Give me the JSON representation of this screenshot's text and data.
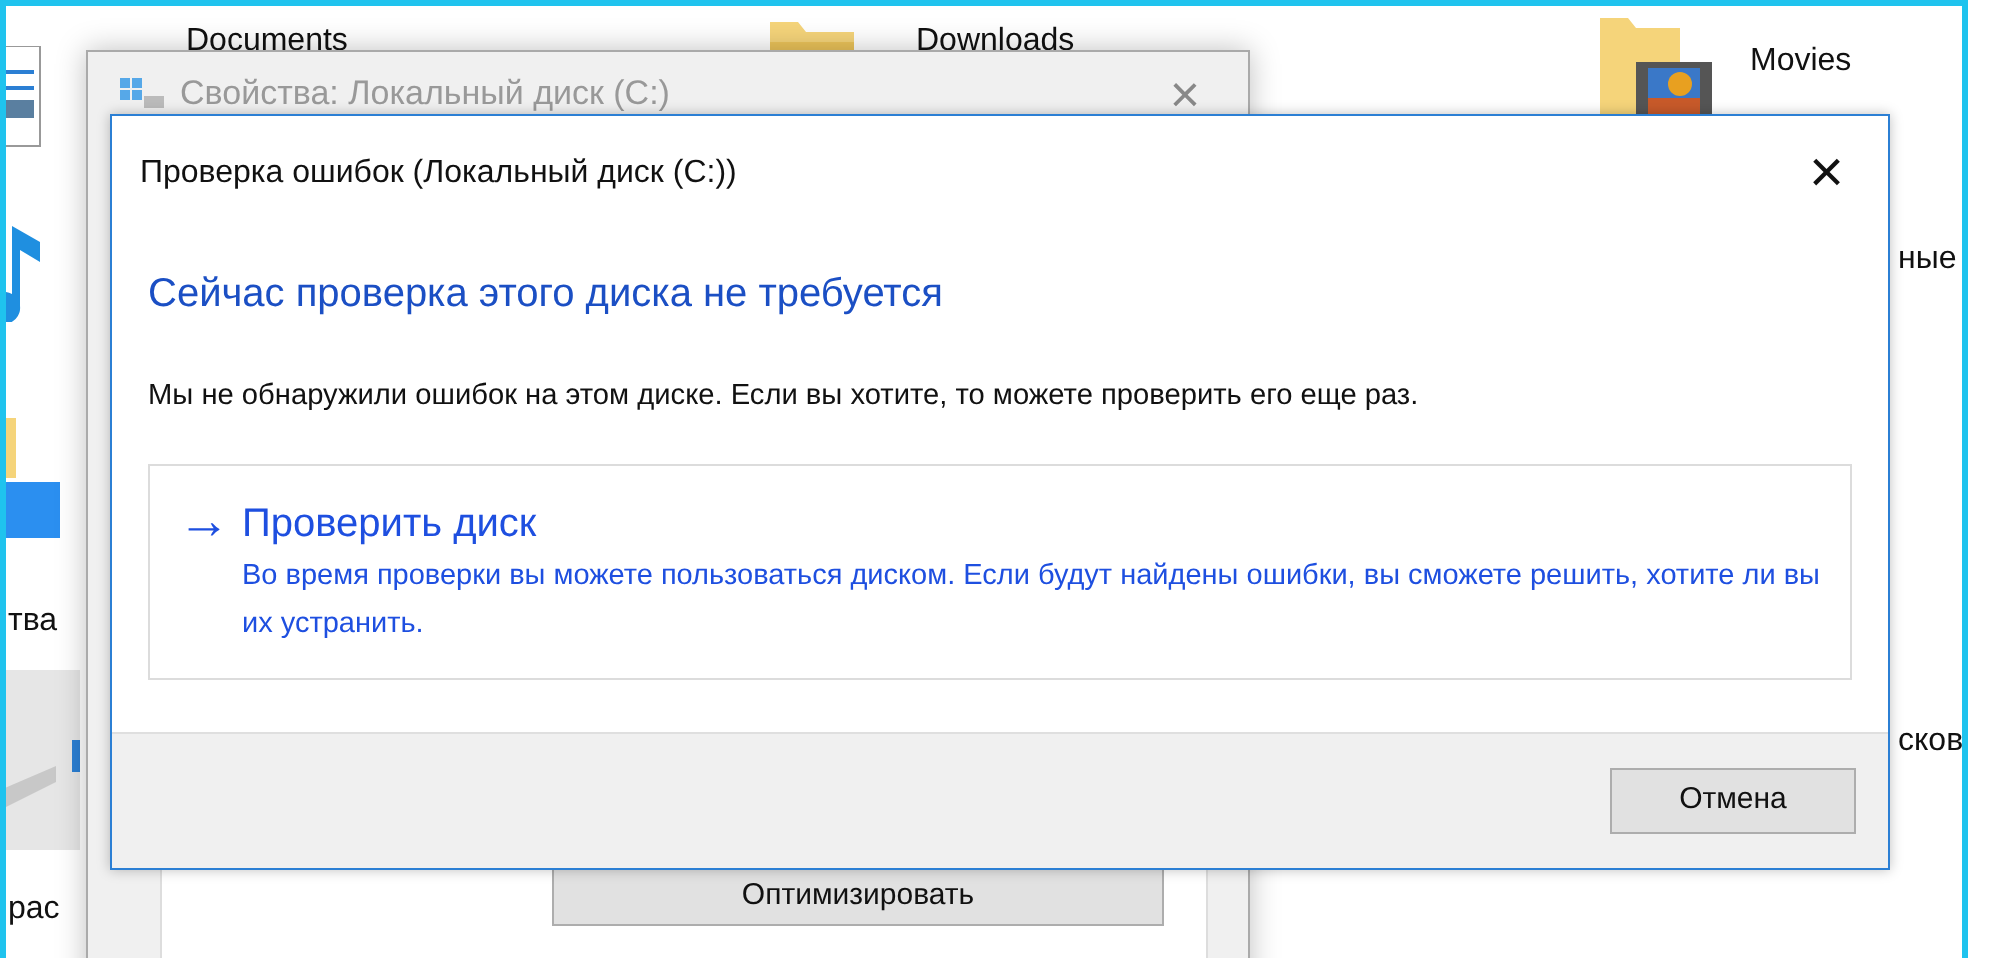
{
  "explorer": {
    "items": [
      {
        "label": "Documents"
      },
      {
        "label": "Downloads"
      },
      {
        "label": "Movies"
      }
    ],
    "side_texts": [
      {
        "text": "тва"
      },
      {
        "text": "рас"
      },
      {
        "text": "ные"
      },
      {
        "text": "сков"
      }
    ]
  },
  "properties_window": {
    "title": "Свойства: Локальный диск (C:)",
    "close": "×",
    "button": "Оптимизировать"
  },
  "dialog": {
    "title": "Проверка ошибок (Локальный диск (C:))",
    "close": "×",
    "heading": "Сейчас проверка этого диска не требуется",
    "message": "Мы не обнаружили ошибок на этом диске. Если вы хотите, то можете проверить его еще раз.",
    "command": {
      "arrow": "→",
      "title": "Проверить диск",
      "description": "Во время проверки вы можете пользоваться диском. Если будут найдены ошибки, вы сможете решить, хотите ли вы их устранить."
    },
    "buttons": [
      "Отмена"
    ]
  }
}
